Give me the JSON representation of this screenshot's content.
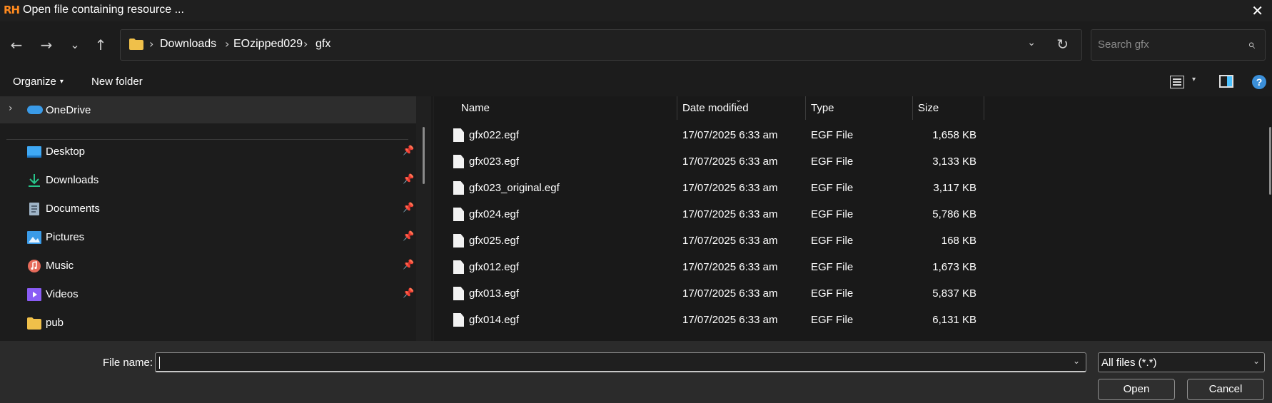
{
  "window": {
    "app_icon": "RH",
    "title": "Open file containing resource ...",
    "close_glyph": "✕"
  },
  "nav": {
    "back_glyph": "←",
    "forward_glyph": "→",
    "recent_glyph": "⌄",
    "up_glyph": "↑"
  },
  "address": {
    "crumbs": [
      "Downloads",
      "EOzipped029",
      "gfx"
    ],
    "sep_glyph": "›",
    "dropdown_glyph": "⌄",
    "refresh_glyph": "↻"
  },
  "search": {
    "placeholder": "Search gfx",
    "icon_glyph": "⌕"
  },
  "toolbar": {
    "organize_label": "Organize",
    "organize_caret": "▾",
    "new_folder_label": "New folder",
    "view_caret": "▾",
    "help_glyph": "?"
  },
  "sidebar": {
    "onedrive_chevron": "›",
    "onedrive_label": "OneDrive",
    "pin_glyph": "📌",
    "quick_access": [
      {
        "label": "Desktop",
        "icon": "desktop-icon",
        "color": "#3fa9f5"
      },
      {
        "label": "Downloads",
        "icon": "downloads-icon",
        "color": "#27c48a"
      },
      {
        "label": "Documents",
        "icon": "documents-icon",
        "color": "#9fb4c7"
      },
      {
        "label": "Pictures",
        "icon": "pictures-icon",
        "color": "#3a9be8"
      },
      {
        "label": "Music",
        "icon": "music-icon",
        "color": "#e66a5a"
      },
      {
        "label": "Videos",
        "icon": "videos-icon",
        "color": "#8a5cf5"
      },
      {
        "label": "pub",
        "icon": "folder-icon",
        "color": "#f0c04a"
      }
    ]
  },
  "file_list": {
    "columns": {
      "name": "Name",
      "date": "Date modified",
      "type": "Type",
      "size": "Size"
    },
    "sort_caret": "⌄",
    "rows": [
      {
        "name": "gfx022.egf",
        "date": "17/07/2025 6:33 am",
        "type": "EGF File",
        "size": "1,658 KB"
      },
      {
        "name": "gfx023.egf",
        "date": "17/07/2025 6:33 am",
        "type": "EGF File",
        "size": "3,133 KB"
      },
      {
        "name": "gfx023_original.egf",
        "date": "17/07/2025 6:33 am",
        "type": "EGF File",
        "size": "3,117 KB"
      },
      {
        "name": "gfx024.egf",
        "date": "17/07/2025 6:33 am",
        "type": "EGF File",
        "size": "5,786 KB"
      },
      {
        "name": "gfx025.egf",
        "date": "17/07/2025 6:33 am",
        "type": "EGF File",
        "size": "168 KB"
      },
      {
        "name": "gfx012.egf",
        "date": "17/07/2025 6:33 am",
        "type": "EGF File",
        "size": "1,673 KB"
      },
      {
        "name": "gfx013.egf",
        "date": "17/07/2025 6:33 am",
        "type": "EGF File",
        "size": "5,837 KB"
      },
      {
        "name": "gfx014.egf",
        "date": "17/07/2025 6:33 am",
        "type": "EGF File",
        "size": "6,131 KB"
      }
    ]
  },
  "footer": {
    "file_name_label": "File name:",
    "file_name_value": "",
    "dropdown_glyph": "⌄",
    "filter_value": "All files (*.*)",
    "open_label": "Open",
    "cancel_label": "Cancel"
  }
}
